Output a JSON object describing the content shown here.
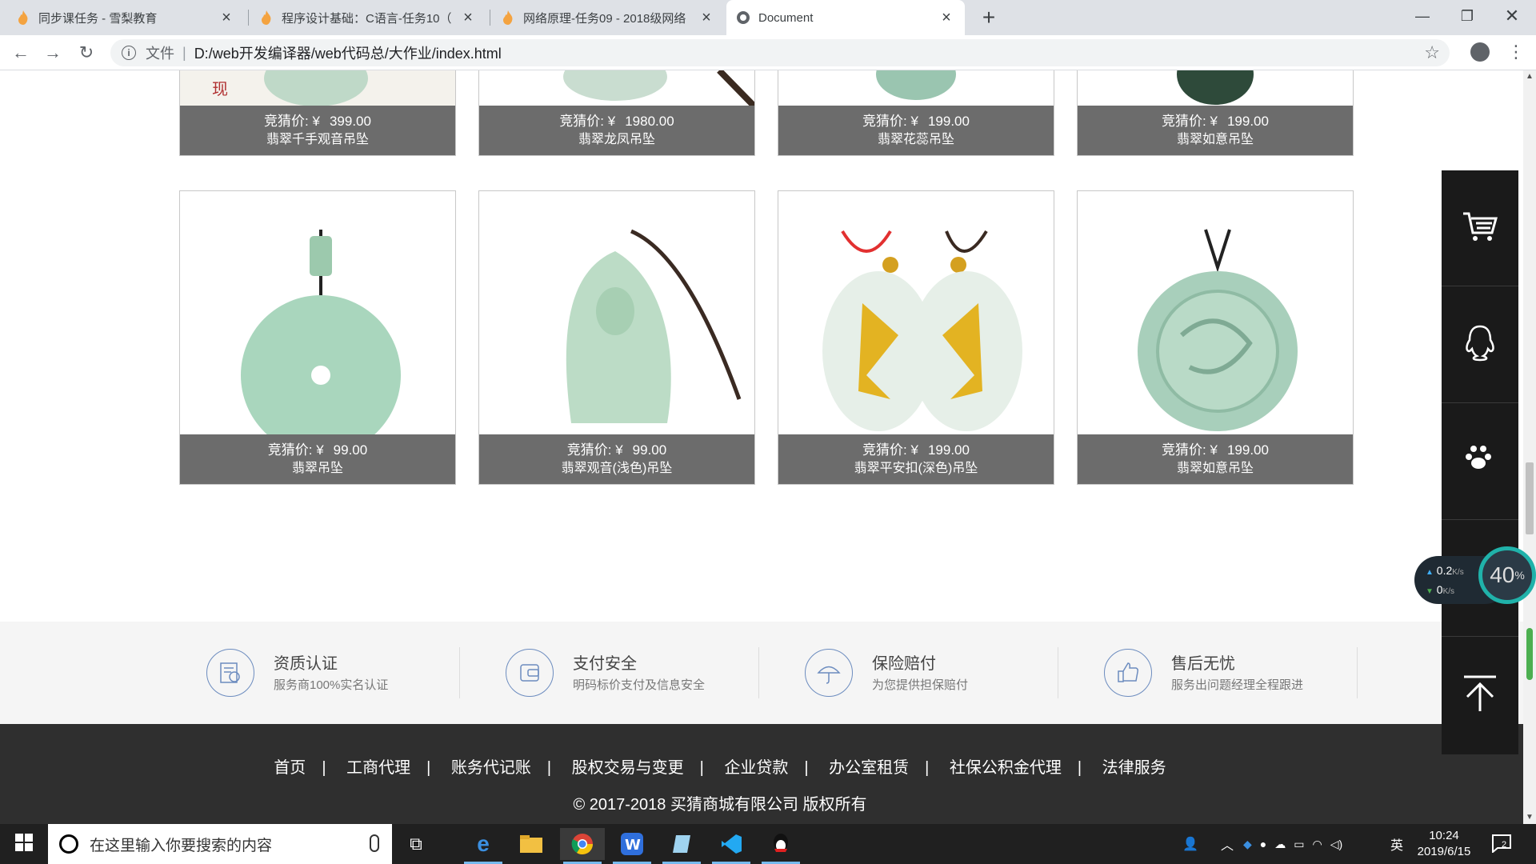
{
  "browser": {
    "tabs": [
      {
        "title": "同步课任务 - 雪梨教育",
        "active": false
      },
      {
        "title": "程序设计基础：C语言-任务10（",
        "active": false
      },
      {
        "title": "网络原理-任务09 - 2018级网络",
        "active": false
      },
      {
        "title": "Document",
        "active": true
      }
    ],
    "omnibox": {
      "scheme": "文件",
      "url": "D:/web开发编译器/web代码总/大作业/index.html"
    }
  },
  "products_top": [
    {
      "price_label": "竞猜价:  ¥",
      "price": "399.00",
      "name": "翡翠千手观音吊坠"
    },
    {
      "price_label": "竞猜价:  ¥",
      "price": "1980.00",
      "name": "翡翠龙凤吊坠"
    },
    {
      "price_label": "竞猜价:  ¥",
      "price": "199.00",
      "name": "翡翠花蕊吊坠"
    },
    {
      "price_label": "竞猜价:  ¥",
      "price": "199.00",
      "name": "翡翠如意吊坠"
    }
  ],
  "products": [
    {
      "price_label": "竞猜价:  ¥",
      "price": "99.00",
      "name": "翡翠吊坠"
    },
    {
      "price_label": "竞猜价:  ¥",
      "price": "99.00",
      "name": "翡翠观音(浅色)吊坠"
    },
    {
      "price_label": "竞猜价:  ¥",
      "price": "199.00",
      "name": "翡翠平安扣(深色)吊坠"
    },
    {
      "price_label": "竞猜价:  ¥",
      "price": "199.00",
      "name": "翡翠如意吊坠"
    }
  ],
  "features": [
    {
      "title": "资质认证",
      "desc": "服务商100%实名认证",
      "icon": "certificate-icon"
    },
    {
      "title": "支付安全",
      "desc": "明码标价支付及信息安全",
      "icon": "wallet-icon"
    },
    {
      "title": "保险赔付",
      "desc": "为您提供担保赔付",
      "icon": "umbrella-icon"
    },
    {
      "title": "售后无忧",
      "desc": "服务出问题经理全程跟进",
      "icon": "thumbs-up-icon"
    }
  ],
  "footer": {
    "links": [
      "首页",
      "工商代理",
      "账务代记账",
      "股权交易与变更",
      "企业贷款",
      "办公室租赁",
      "社保公积金代理",
      "法律服务"
    ],
    "separator": "|",
    "copyright": "© 2017-2018 买猜商城有限公司 版权所有"
  },
  "sidebar": [
    "cart-icon",
    "qq-icon",
    "paw-icon",
    "qrcode-icon",
    "back-to-top-icon"
  ],
  "netwidget": {
    "up": "0.2",
    "up_unit": "K/s",
    "down": "0",
    "down_unit": "K/s",
    "percent": "40",
    "percent_unit": "%"
  },
  "taskbar": {
    "search_placeholder": "在这里输入你要搜索的内容",
    "ime": "英",
    "time": "10:24",
    "date": "2019/6/15",
    "notification_count": "2"
  }
}
